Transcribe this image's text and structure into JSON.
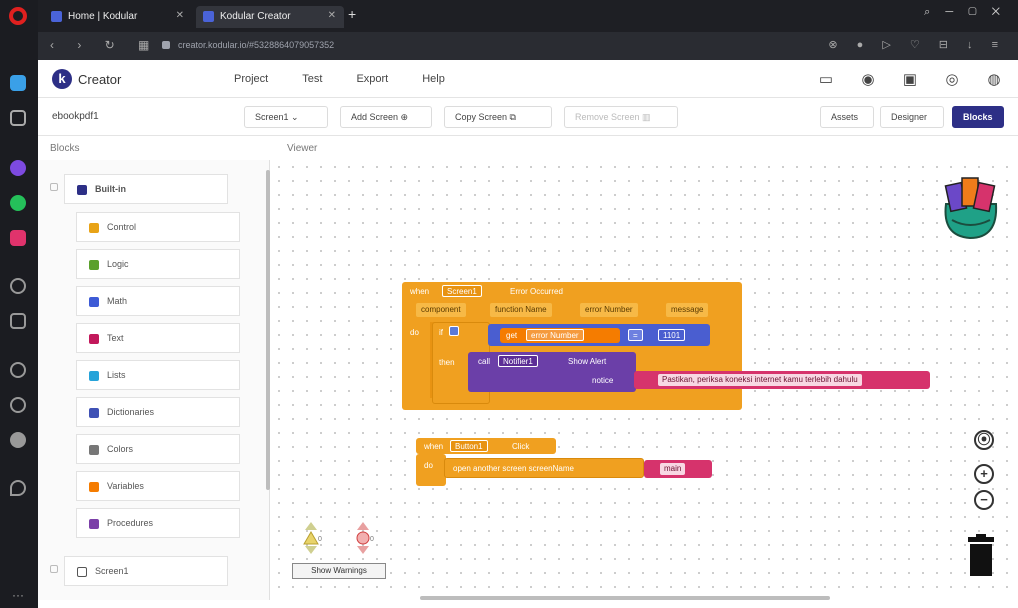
{
  "browser": {
    "tabs": [
      {
        "title": "Home | Kodular"
      },
      {
        "title": "Kodular Creator"
      }
    ],
    "url": "creator.kodular.io/#5328864079057352"
  },
  "app": {
    "name": "Creator",
    "menu": [
      "Project",
      "Test",
      "Export",
      "Help"
    ]
  },
  "toolbar": {
    "project_name": "ebookpdf1",
    "screen": "Screen1",
    "add_screen": "Add Screen",
    "copy_screen": "Copy Screen",
    "remove_screen": "Remove Screen",
    "assets": "Assets",
    "designer": "Designer",
    "blocks": "Blocks"
  },
  "panels": {
    "blocks_title": "Blocks",
    "viewer_title": "Viewer"
  },
  "blocks_tree": {
    "builtin": "Built-in",
    "items": [
      {
        "label": "Control",
        "color": "#e8a317"
      },
      {
        "label": "Logic",
        "color": "#5aa02c"
      },
      {
        "label": "Math",
        "color": "#3d5bd6"
      },
      {
        "label": "Text",
        "color": "#c2185b"
      },
      {
        "label": "Lists",
        "color": "#26a3d9"
      },
      {
        "label": "Dictionaries",
        "color": "#3f51b5"
      },
      {
        "label": "Colors",
        "color": "#777777"
      },
      {
        "label": "Variables",
        "color": "#f57c00"
      },
      {
        "label": "Procedures",
        "color": "#7b3fa8"
      }
    ],
    "screen": "Screen1"
  },
  "code_blocks": {
    "error_event": {
      "when": "when",
      "component": "Screen1",
      "event": "Error Occurred",
      "params": [
        "component",
        "function Name",
        "error Number",
        "message"
      ],
      "do": "do",
      "if": "if",
      "then": "then",
      "get": "get",
      "var": "error Number",
      "op": "=",
      "value": "1101",
      "call": "call",
      "notifier": "Notifier1",
      "method": "Show Alert",
      "notice_label": "notice",
      "notice_text": "Pastikan, periksa koneksi internet kamu terlebih dahulu"
    },
    "click_event": {
      "when": "when",
      "component": "Button1",
      "event": "Click",
      "do": "do",
      "action": "open another screen  screenName",
      "screen_name": "main"
    }
  },
  "workspace": {
    "show_warnings": "Show Warnings",
    "warning_count": "0",
    "error_count": "0"
  }
}
